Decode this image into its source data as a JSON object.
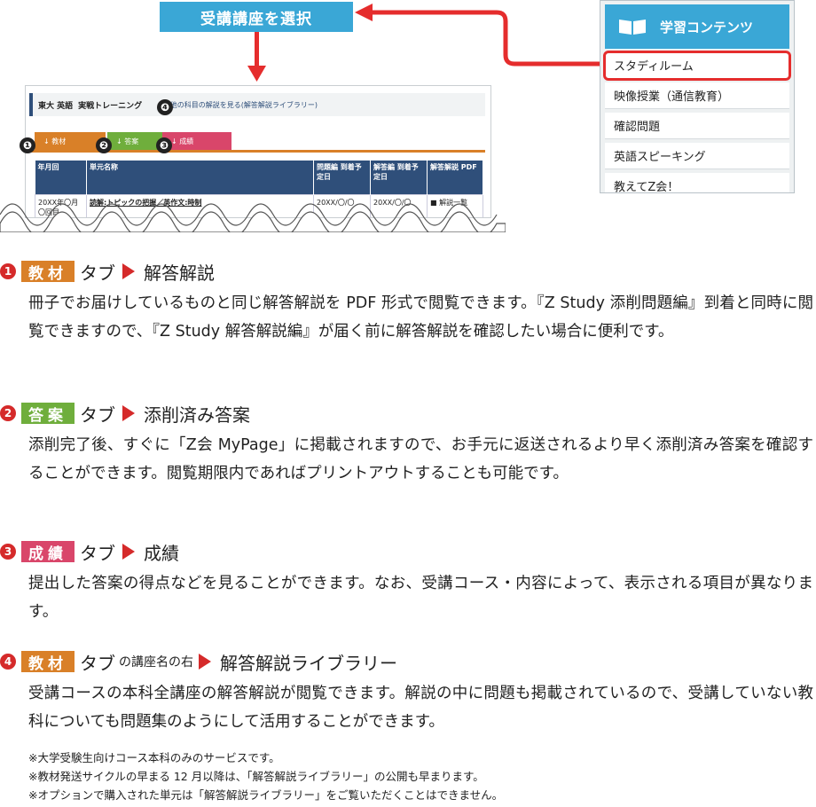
{
  "callout": {
    "label": "受講講座を選択"
  },
  "panel": {
    "header": "学習コンテンツ",
    "items": [
      "スタディルーム",
      "映像授業（通信教育）",
      "確認問題",
      "英語スピーキング",
      "教えてZ会！"
    ]
  },
  "mock": {
    "title_subject": "東大 英語",
    "title_course": "実戦トレーニング",
    "title_link": "■他の科目の解説を見る(解答解説ライブラリー)",
    "tabs": [
      "↓ 教材",
      "↓ 答案",
      "↓ 成績"
    ],
    "headers": [
      "年月回",
      "単元名称",
      "問題編 到着予定日",
      "解答編 到着予定日",
      "解答解説 PDF"
    ],
    "row": [
      "20XX年〇月 〇回目",
      "読解:トピックの把握／英作文:時制",
      "20XX/〇/〇",
      "20XX/〇/〇",
      "■ 解説一覧"
    ],
    "badges": [
      "❶",
      "❷",
      "❸",
      "❹"
    ]
  },
  "sections": [
    {
      "num": "1",
      "tag": "教材",
      "tab": "タブ",
      "sub": "",
      "title": "解答解説",
      "body": "冊子でお届けしているものと同じ解答解説を PDF 形式で閲覧できます。『Z Study 添削問題編』到着と同時に閲覧できますので、『Z Study 解答解説編』が届く前に解答解説を確認したい場合に便利です。"
    },
    {
      "num": "2",
      "tag": "答案",
      "tab": "タブ",
      "sub": "",
      "title": "添削済み答案",
      "body": "添削完了後、すぐに「Z会 MyPage」に掲載されますので、お手元に返送されるより早く添削済み答案を確認することができます。閲覧期限内であればプリントアウトすることも可能です。"
    },
    {
      "num": "3",
      "tag": "成績",
      "tab": "タブ",
      "sub": "",
      "title": "成績",
      "body": "提出した答案の得点などを見ることができます。なお、受講コース・内容によって、表示される項目が異なります。"
    },
    {
      "num": "4",
      "tag": "教材",
      "tab": "タブ",
      "sub": "の講座名の右",
      "title": "解答解説ライブラリー",
      "body": "受講コースの本科全講座の解答解説が閲覧できます。解説の中に問題も掲載されているので、受講していない教科についても問題集のようにして活用することができます。"
    }
  ],
  "notes": [
    "※大学受験生向けコース本科のみのサービスです。",
    "※教材発送サイクルの早まる 12 月以降は、「解答解説ライブラリー」の公開も早まります。",
    "※オプションで購入された単元は「解答解説ライブラリー」をご覧いただくことはできません。"
  ],
  "colors": {
    "blue": "#3aa7d6",
    "red": "#e52d2d",
    "orange": "#d98028",
    "green": "#6fae3c",
    "pink": "#d9466a",
    "navy": "#2f4f7a"
  }
}
